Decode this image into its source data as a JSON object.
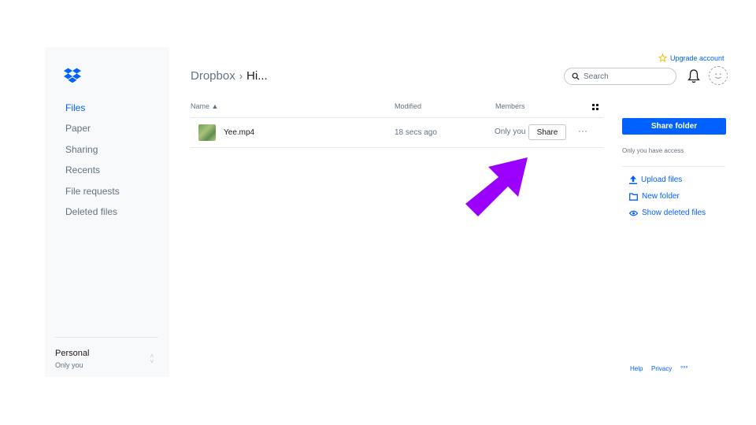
{
  "sidebar": {
    "items": [
      {
        "label": "Files",
        "active": true
      },
      {
        "label": "Paper"
      },
      {
        "label": "Sharing"
      },
      {
        "label": "Recents"
      },
      {
        "label": "File requests"
      },
      {
        "label": "Deleted files"
      }
    ],
    "account": {
      "name": "Personal",
      "sub": "Only you"
    }
  },
  "header": {
    "breadcrumb_root": "Dropbox",
    "breadcrumb_separator": "›",
    "breadcrumb_current": "Hi...",
    "upgrade_label": "Upgrade account",
    "search_placeholder": "Search"
  },
  "table": {
    "columns": {
      "name": "Name ▲",
      "modified": "Modified",
      "members": "Members"
    },
    "rows": [
      {
        "name": "Yee.mp4",
        "modified": "18 secs ago",
        "members": "Only you",
        "share_label": "Share",
        "more_label": "···"
      }
    ]
  },
  "right_panel": {
    "share_folder_label": "Share folder",
    "access_note": "Only you have access",
    "actions": [
      {
        "label": "Upload files",
        "icon": "upload-icon"
      },
      {
        "label": "New folder",
        "icon": "folder-icon"
      },
      {
        "label": "Show deleted files",
        "icon": "eye-icon"
      }
    ]
  },
  "footer": {
    "help": "Help",
    "privacy": "Privacy",
    "more": "°°°"
  },
  "colors": {
    "accent": "#0061fe",
    "arrow": "#9b00ff",
    "sidebar_bg": "#f7f9fa",
    "muted_text": "#637282"
  }
}
